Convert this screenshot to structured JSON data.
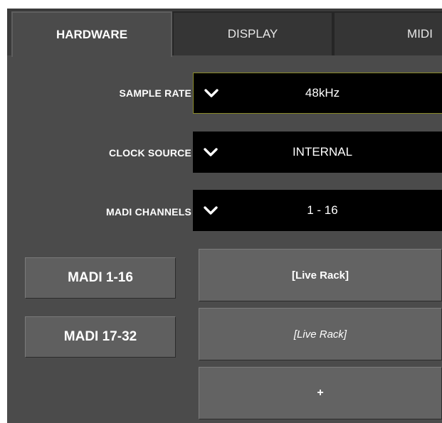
{
  "tabs": [
    {
      "label": "HARDWARE",
      "active": true
    },
    {
      "label": "DISPLAY",
      "active": false
    },
    {
      "label": "MIDI",
      "active": false
    }
  ],
  "settings": {
    "sample_rate": {
      "label": "SAMPLE RATE",
      "value": "48kHz"
    },
    "clock_source": {
      "label": "CLOCK SOURCE",
      "value": "INTERNAL"
    },
    "madi_channels": {
      "label": "MADI CHANNELS",
      "value": "1 - 16"
    }
  },
  "madi_banks": [
    {
      "label": "MADI 1-16",
      "assignment": "[Live Rack]"
    },
    {
      "label": "MADI 17-32",
      "assignment": "[Live Rack]"
    }
  ],
  "add_slot_label": "+",
  "icons": {
    "dropdown": "chevron-down-icon"
  },
  "colors": {
    "panel_bg": "#4b4b4b",
    "select_bg": "#000000",
    "focus_border": "#8a8a2a"
  }
}
